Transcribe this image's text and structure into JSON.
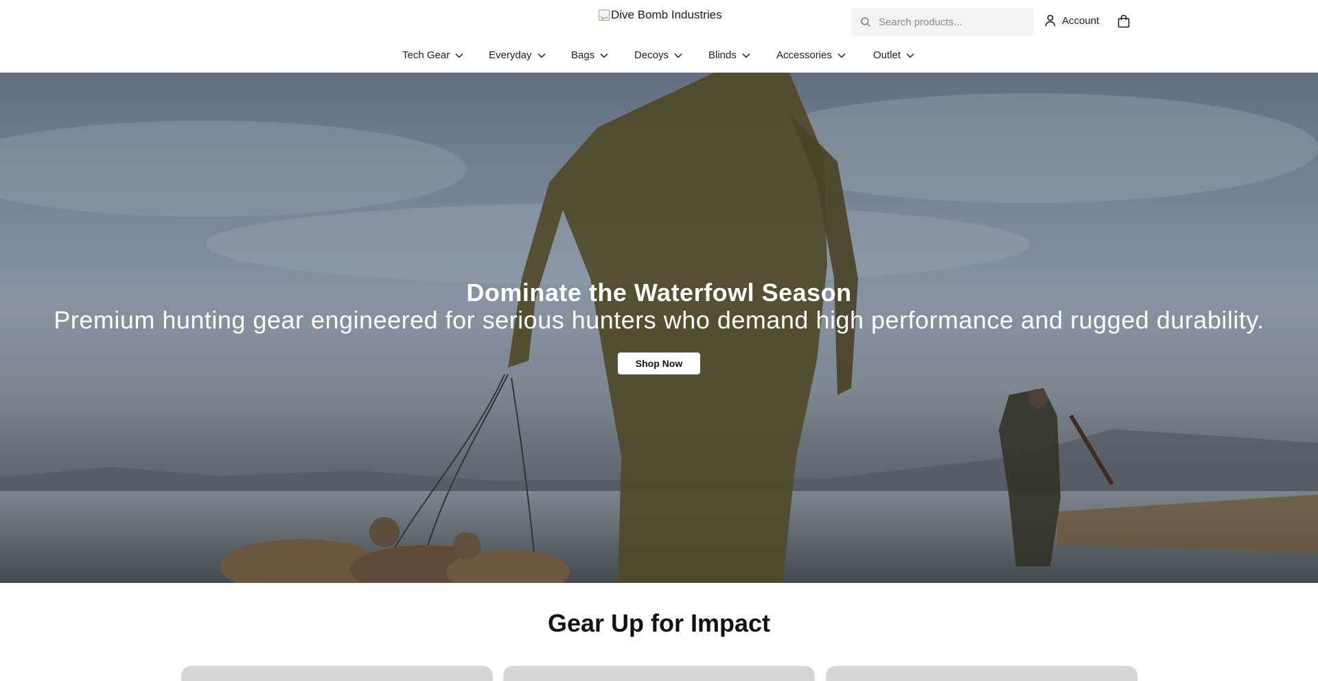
{
  "header": {
    "logo_alt": "Dive Bomb Industries",
    "search_placeholder": "Search products...",
    "account_label": "Account",
    "icons": {
      "search": "search-icon",
      "account": "user-icon",
      "cart": "shopping-bag-icon",
      "dropdown": "chevron-down-icon"
    }
  },
  "nav": {
    "items": [
      {
        "label": "Tech Gear"
      },
      {
        "label": "Everyday"
      },
      {
        "label": "Bags"
      },
      {
        "label": "Decoys"
      },
      {
        "label": "Blinds"
      },
      {
        "label": "Accessories"
      },
      {
        "label": "Outlet"
      }
    ]
  },
  "hero": {
    "title": "Dominate the Waterfowl Season",
    "subtitle": "Premium hunting gear engineered for serious hunters who demand high performance and rugged durability.",
    "cta_label": "Shop Now"
  },
  "section": {
    "title": "Gear Up for Impact",
    "card_count": 3
  },
  "colors": {
    "text": "#111111",
    "button_bg": "#ffffff",
    "search_bg": "#f3f3f3",
    "card_placeholder": "#d6d6d6"
  }
}
